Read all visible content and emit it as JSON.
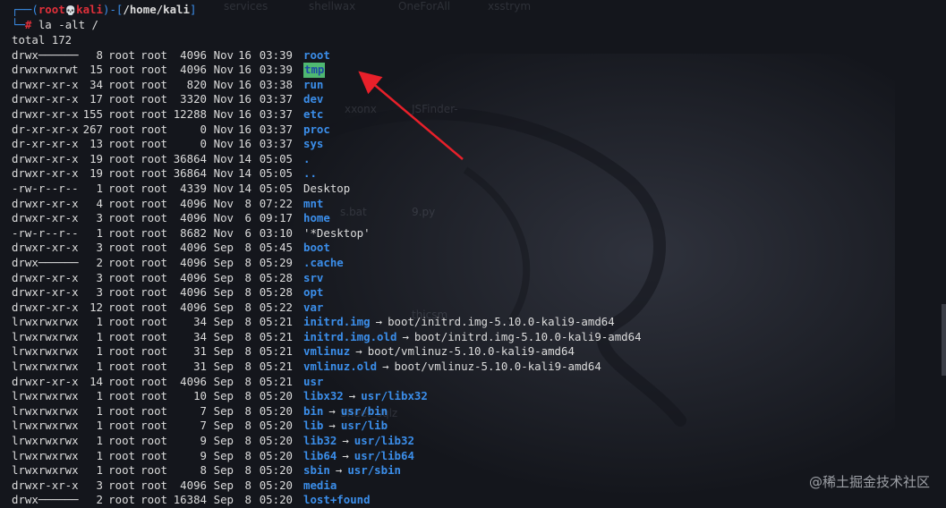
{
  "wallpaper": {
    "labels": [
      "services",
      "shellwax",
      "OneForAll",
      "xsstrym",
      "xxonx",
      "JSFinder-",
      "9.py",
      "s.bat",
      "thicsm",
      "Sheet_sqlz"
    ]
  },
  "prompt": {
    "bracket_open": "┌──(",
    "user": "root",
    "skull": "💀",
    "host": "kali",
    "bracket_close": ")-[",
    "path": "/home/kali",
    "path_close": "]",
    "corner": "└─",
    "hash": "#",
    "command": " la -alt /"
  },
  "total_line": "total 172",
  "entries": [
    {
      "perm": "drwx──────",
      "links": "8",
      "owner": "root",
      "group": "root",
      "size": "4096",
      "month": "Nov",
      "day": "16",
      "time": "03:39",
      "name": "root",
      "style": "dir",
      "target": ""
    },
    {
      "perm": "drwxrwxrwt",
      "links": "15",
      "owner": "root",
      "group": "root",
      "size": "4096",
      "month": "Nov",
      "day": "16",
      "time": "03:39",
      "name": "tmp",
      "style": "hl",
      "target": ""
    },
    {
      "perm": "drwxr-xr-x",
      "links": "34",
      "owner": "root",
      "group": "root",
      "size": "820",
      "month": "Nov",
      "day": "16",
      "time": "03:38",
      "name": "run",
      "style": "dir",
      "target": ""
    },
    {
      "perm": "drwxr-xr-x",
      "links": "17",
      "owner": "root",
      "group": "root",
      "size": "3320",
      "month": "Nov",
      "day": "16",
      "time": "03:37",
      "name": "dev",
      "style": "dir",
      "target": ""
    },
    {
      "perm": "drwxr-xr-x",
      "links": "155",
      "owner": "root",
      "group": "root",
      "size": "12288",
      "month": "Nov",
      "day": "16",
      "time": "03:37",
      "name": "etc",
      "style": "dir",
      "target": ""
    },
    {
      "perm": "dr-xr-xr-x",
      "links": "267",
      "owner": "root",
      "group": "root",
      "size": "0",
      "month": "Nov",
      "day": "16",
      "time": "03:37",
      "name": "proc",
      "style": "dir",
      "target": ""
    },
    {
      "perm": "dr-xr-xr-x",
      "links": "13",
      "owner": "root",
      "group": "root",
      "size": "0",
      "month": "Nov",
      "day": "16",
      "time": "03:37",
      "name": "sys",
      "style": "dir",
      "target": ""
    },
    {
      "perm": "drwxr-xr-x",
      "links": "19",
      "owner": "root",
      "group": "root",
      "size": "36864",
      "month": "Nov",
      "day": "14",
      "time": "05:05",
      "name": ".",
      "style": "dir",
      "target": ""
    },
    {
      "perm": "drwxr-xr-x",
      "links": "19",
      "owner": "root",
      "group": "root",
      "size": "36864",
      "month": "Nov",
      "day": "14",
      "time": "05:05",
      "name": "..",
      "style": "dir",
      "target": ""
    },
    {
      "perm": "-rw-r--r--",
      "links": "1",
      "owner": "root",
      "group": "root",
      "size": "4339",
      "month": "Nov",
      "day": "14",
      "time": "05:05",
      "name": "Desktop",
      "style": "plain",
      "target": ""
    },
    {
      "perm": "drwxr-xr-x",
      "links": "4",
      "owner": "root",
      "group": "root",
      "size": "4096",
      "month": "Nov",
      "day": "8",
      "time": "07:22",
      "name": "mnt",
      "style": "dir",
      "target": ""
    },
    {
      "perm": "drwxr-xr-x",
      "links": "3",
      "owner": "root",
      "group": "root",
      "size": "4096",
      "month": "Nov",
      "day": "6",
      "time": "09:17",
      "name": "home",
      "style": "dir",
      "target": ""
    },
    {
      "perm": "-rw-r--r--",
      "links": "1",
      "owner": "root",
      "group": "root",
      "size": "8682",
      "month": "Nov",
      "day": "6",
      "time": "03:10",
      "name": "'*Desktop'",
      "style": "plain",
      "target": ""
    },
    {
      "perm": "drwxr-xr-x",
      "links": "3",
      "owner": "root",
      "group": "root",
      "size": "4096",
      "month": "Sep",
      "day": "8",
      "time": "05:45",
      "name": "boot",
      "style": "dir",
      "target": ""
    },
    {
      "perm": "drwx──────",
      "links": "2",
      "owner": "root",
      "group": "root",
      "size": "4096",
      "month": "Sep",
      "day": "8",
      "time": "05:29",
      "name": ".cache",
      "style": "dir",
      "target": ""
    },
    {
      "perm": "drwxr-xr-x",
      "links": "3",
      "owner": "root",
      "group": "root",
      "size": "4096",
      "month": "Sep",
      "day": "8",
      "time": "05:28",
      "name": "srv",
      "style": "dir",
      "target": ""
    },
    {
      "perm": "drwxr-xr-x",
      "links": "3",
      "owner": "root",
      "group": "root",
      "size": "4096",
      "month": "Sep",
      "day": "8",
      "time": "05:28",
      "name": "opt",
      "style": "dir",
      "target": ""
    },
    {
      "perm": "drwxr-xr-x",
      "links": "12",
      "owner": "root",
      "group": "root",
      "size": "4096",
      "month": "Sep",
      "day": "8",
      "time": "05:22",
      "name": "var",
      "style": "dir",
      "target": ""
    },
    {
      "perm": "lrwxrwxrwx",
      "links": "1",
      "owner": "root",
      "group": "root",
      "size": "34",
      "month": "Sep",
      "day": "8",
      "time": "05:21",
      "name": "initrd.img",
      "style": "dir",
      "target": "boot/initrd.img-5.10.0-kali9-amd64",
      "target_style": "plain"
    },
    {
      "perm": "lrwxrwxrwx",
      "links": "1",
      "owner": "root",
      "group": "root",
      "size": "34",
      "month": "Sep",
      "day": "8",
      "time": "05:21",
      "name": "initrd.img.old",
      "style": "dir",
      "target": "boot/initrd.img-5.10.0-kali9-amd64",
      "target_style": "plain"
    },
    {
      "perm": "lrwxrwxrwx",
      "links": "1",
      "owner": "root",
      "group": "root",
      "size": "31",
      "month": "Sep",
      "day": "8",
      "time": "05:21",
      "name": "vmlinuz",
      "style": "dir",
      "target": "boot/vmlinuz-5.10.0-kali9-amd64",
      "target_style": "plain"
    },
    {
      "perm": "lrwxrwxrwx",
      "links": "1",
      "owner": "root",
      "group": "root",
      "size": "31",
      "month": "Sep",
      "day": "8",
      "time": "05:21",
      "name": "vmlinuz.old",
      "style": "dir",
      "target": "boot/vmlinuz-5.10.0-kali9-amd64",
      "target_style": "plain"
    },
    {
      "perm": "drwxr-xr-x",
      "links": "14",
      "owner": "root",
      "group": "root",
      "size": "4096",
      "month": "Sep",
      "day": "8",
      "time": "05:21",
      "name": "usr",
      "style": "dir",
      "target": ""
    },
    {
      "perm": "lrwxrwxrwx",
      "links": "1",
      "owner": "root",
      "group": "root",
      "size": "10",
      "month": "Sep",
      "day": "8",
      "time": "05:20",
      "name": "libx32",
      "style": "dir",
      "target": "usr/libx32",
      "target_style": "dir"
    },
    {
      "perm": "lrwxrwxrwx",
      "links": "1",
      "owner": "root",
      "group": "root",
      "size": "7",
      "month": "Sep",
      "day": "8",
      "time": "05:20",
      "name": "bin",
      "style": "dir",
      "target": "usr/bin",
      "target_style": "dir"
    },
    {
      "perm": "lrwxrwxrwx",
      "links": "1",
      "owner": "root",
      "group": "root",
      "size": "7",
      "month": "Sep",
      "day": "8",
      "time": "05:20",
      "name": "lib",
      "style": "dir",
      "target": "usr/lib",
      "target_style": "dir"
    },
    {
      "perm": "lrwxrwxrwx",
      "links": "1",
      "owner": "root",
      "group": "root",
      "size": "9",
      "month": "Sep",
      "day": "8",
      "time": "05:20",
      "name": "lib32",
      "style": "dir",
      "target": "usr/lib32",
      "target_style": "dir"
    },
    {
      "perm": "lrwxrwxrwx",
      "links": "1",
      "owner": "root",
      "group": "root",
      "size": "9",
      "month": "Sep",
      "day": "8",
      "time": "05:20",
      "name": "lib64",
      "style": "dir",
      "target": "usr/lib64",
      "target_style": "dir"
    },
    {
      "perm": "lrwxrwxrwx",
      "links": "1",
      "owner": "root",
      "group": "root",
      "size": "8",
      "month": "Sep",
      "day": "8",
      "time": "05:20",
      "name": "sbin",
      "style": "dir",
      "target": "usr/sbin",
      "target_style": "dir"
    },
    {
      "perm": "drwxr-xr-x",
      "links": "3",
      "owner": "root",
      "group": "root",
      "size": "4096",
      "month": "Sep",
      "day": "8",
      "time": "05:20",
      "name": "media",
      "style": "dir",
      "target": ""
    },
    {
      "perm": "drwx──────",
      "links": "2",
      "owner": "root",
      "group": "root",
      "size": "16384",
      "month": "Sep",
      "day": "8",
      "time": "05:20",
      "name": "lost+found",
      "style": "dir",
      "target": ""
    }
  ],
  "symlink_arrow": "→",
  "watermark": "@稀土掘金技术社区",
  "colors": {
    "background": "#14161c",
    "directory": "#3b8eea",
    "prompt_red": "#e0303a",
    "highlight_bg": "#4fb871",
    "annotation_arrow": "#e8202a"
  }
}
